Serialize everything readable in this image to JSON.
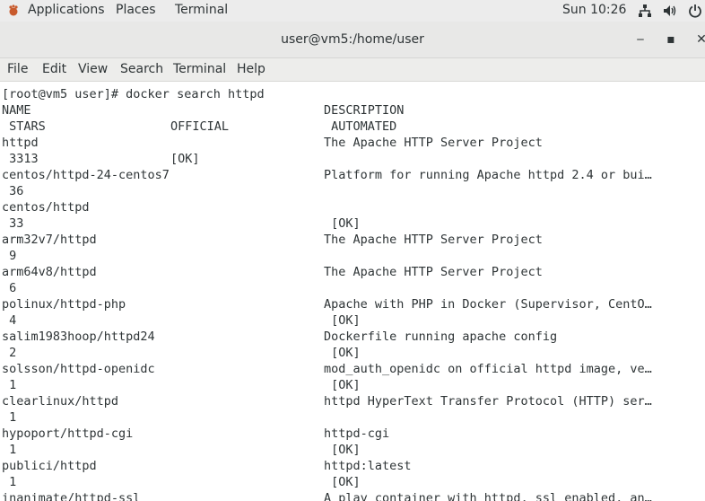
{
  "topbar": {
    "applications": "Applications",
    "places": "Places",
    "terminal": "Terminal",
    "clock": "Sun 10:26",
    "icons": [
      "network-icon",
      "volume-icon",
      "power-icon"
    ]
  },
  "window": {
    "title": "user@vm5:/home/user",
    "controls": {
      "minimize": "‒",
      "maximize": "▪",
      "close": "✕"
    }
  },
  "menubar": [
    "File",
    "Edit",
    "View",
    "Search",
    "Terminal",
    "Help"
  ],
  "terminal": {
    "lines": [
      {
        "c1": "[root@vm5 user]# docker search httpd",
        "c2": "",
        "c3": ""
      },
      {
        "c1": "NAME",
        "c2": "",
        "c3": "DESCRIPTION"
      },
      {
        "c1": " STARS",
        "c2": "OFFICIAL",
        "c3": " AUTOMATED"
      },
      {
        "c1": "httpd",
        "c2": "",
        "c3": "The Apache HTTP Server Project"
      },
      {
        "c1": " 3313",
        "c2": "[OK]",
        "c3": ""
      },
      {
        "c1": "centos/httpd-24-centos7",
        "c2": "",
        "c3": "Platform for running Apache httpd 2.4 or bui…"
      },
      {
        "c1": " 36",
        "c2": "",
        "c3": ""
      },
      {
        "c1": "centos/httpd",
        "c2": "",
        "c3": ""
      },
      {
        "c1": " 33",
        "c2": "",
        "c3": " [OK]"
      },
      {
        "c1": "arm32v7/httpd",
        "c2": "",
        "c3": "The Apache HTTP Server Project"
      },
      {
        "c1": " 9",
        "c2": "",
        "c3": ""
      },
      {
        "c1": "arm64v8/httpd",
        "c2": "",
        "c3": "The Apache HTTP Server Project"
      },
      {
        "c1": " 6",
        "c2": "",
        "c3": ""
      },
      {
        "c1": "polinux/httpd-php",
        "c2": "",
        "c3": "Apache with PHP in Docker (Supervisor, CentO…"
      },
      {
        "c1": " 4",
        "c2": "",
        "c3": " [OK]"
      },
      {
        "c1": "salim1983hoop/httpd24",
        "c2": "",
        "c3": "Dockerfile running apache config"
      },
      {
        "c1": " 2",
        "c2": "",
        "c3": " [OK]"
      },
      {
        "c1": "solsson/httpd-openidc",
        "c2": "",
        "c3": "mod_auth_openidc on official httpd image, ve…"
      },
      {
        "c1": " 1",
        "c2": "",
        "c3": " [OK]"
      },
      {
        "c1": "clearlinux/httpd",
        "c2": "",
        "c3": "httpd HyperText Transfer Protocol (HTTP) ser…"
      },
      {
        "c1": " 1",
        "c2": "",
        "c3": ""
      },
      {
        "c1": "hypoport/httpd-cgi",
        "c2": "",
        "c3": "httpd-cgi"
      },
      {
        "c1": " 1",
        "c2": "",
        "c3": " [OK]"
      },
      {
        "c1": "publici/httpd",
        "c2": "",
        "c3": "httpd:latest"
      },
      {
        "c1": " 1",
        "c2": "",
        "c3": " [OK]"
      },
      {
        "c1": "inanimate/httpd-ssl",
        "c2": "",
        "c3": "A play container with httpd, ssl enabled, an…"
      }
    ]
  }
}
